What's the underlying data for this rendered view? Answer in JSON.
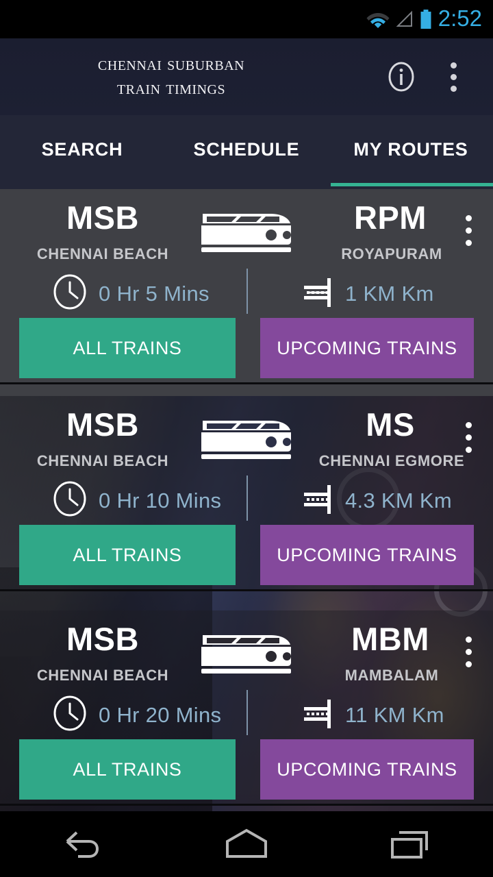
{
  "status_bar": {
    "wifi_icon": "wifi-icon",
    "signal_icon": "signal-no-service-icon",
    "battery_icon": "battery-full-icon",
    "time": "2:52",
    "accent_color": "#35AEE4"
  },
  "app_bar": {
    "title_line1": "Chennai Suburban",
    "title_line2": "Train Timings",
    "info_icon": "info-circle-icon",
    "overflow_icon": "overflow-menu-icon",
    "background_color": "#1b1e30"
  },
  "tabs": {
    "items": [
      {
        "label": "SEARCH",
        "active": false
      },
      {
        "label": "SCHEDULE",
        "active": false
      },
      {
        "label": "MY ROUTES",
        "active": true
      }
    ],
    "indicator_color": "#35b393",
    "background_color": "#232637"
  },
  "routes": [
    {
      "from_code": "MSB",
      "from_name": "CHENNAI BEACH",
      "to_code": "RPM",
      "to_name": "ROYAPURAM",
      "duration": "0 Hr 5 Mins",
      "distance": "1 KM Km",
      "train_icon": "train-icon",
      "clock_icon": "clock-icon",
      "distance_icon": "distance-measure-icon",
      "overflow_icon": "card-overflow-menu-icon",
      "all_trains_label": "ALL TRAINS",
      "upcoming_trains_label": "UPCOMING TRAINS"
    },
    {
      "from_code": "MSB",
      "from_name": "CHENNAI BEACH",
      "to_code": "MS",
      "to_name": "CHENNAI EGMORE",
      "duration": "0 Hr 10 Mins",
      "distance": "4.3 KM Km",
      "train_icon": "train-icon",
      "clock_icon": "clock-icon",
      "distance_icon": "distance-measure-icon",
      "overflow_icon": "card-overflow-menu-icon",
      "all_trains_label": "ALL TRAINS",
      "upcoming_trains_label": "UPCOMING TRAINS"
    },
    {
      "from_code": "MSB",
      "from_name": "CHENNAI BEACH",
      "to_code": "MBM",
      "to_name": "MAMBALAM",
      "duration": "0 Hr 20 Mins",
      "distance": "11 KM Km",
      "train_icon": "train-icon",
      "clock_icon": "clock-icon",
      "distance_icon": "distance-measure-icon",
      "overflow_icon": "card-overflow-menu-icon",
      "all_trains_label": "ALL TRAINS",
      "upcoming_trains_label": "UPCOMING TRAINS"
    }
  ],
  "theme": {
    "all_trains_color": "#30a888",
    "upcoming_trains_color": "#84499c",
    "metric_text_color": "#8fb3cc",
    "card_solid_color": "#3f4045"
  },
  "nav_bar": {
    "back_icon": "back-arrow-icon",
    "home_icon": "home-icon",
    "recents_icon": "recent-apps-icon"
  }
}
